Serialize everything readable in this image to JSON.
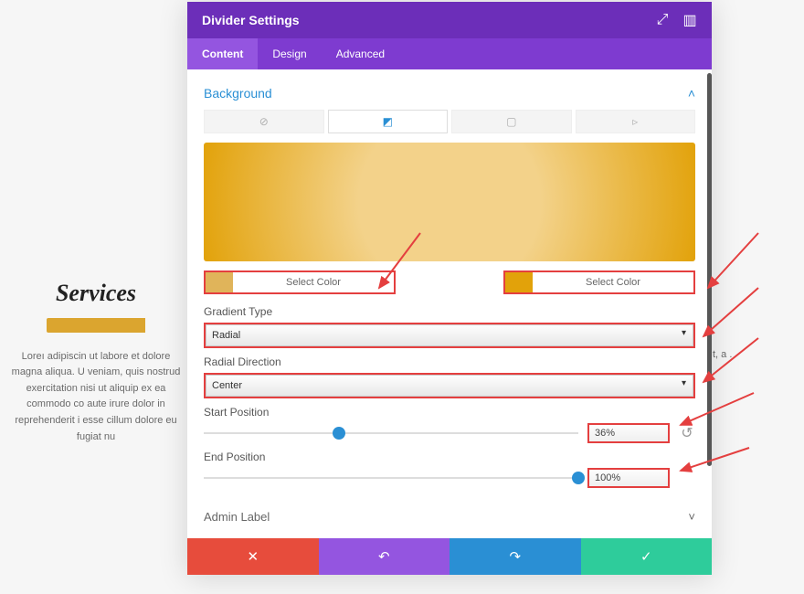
{
  "page": {
    "services_title": "Services",
    "lorem": "Loreı\nadipiscin\nut labore et dolore magna aliqua. U\nveniam, quis nostrud exercitation\nnisi ut aliquip ex ea commodo co\naute irure dolor in reprehenderit i\nesse cillum dolore eu fugiat nu",
    "lorem_right": "t,\n a\n.\n"
  },
  "modal": {
    "title": "Divider Settings",
    "tabs": {
      "content": "Content",
      "design": "Design",
      "advanced": "Advanced"
    },
    "section_background": "Background",
    "bg_type_icons": {
      "color": "⊘",
      "gradient": "◩",
      "image": "▢",
      "video": "▹"
    },
    "color1": {
      "swatch": "#e0b45a",
      "label": "Select Color"
    },
    "color2": {
      "swatch": "#e2a20a",
      "label": "Select Color"
    },
    "preview_gradient": "radial-gradient(circle at center, #f3d28a 0%, #f3d28a 36%, #e2a20a 100%)",
    "gradient_type": {
      "label": "Gradient Type",
      "value": "Radial"
    },
    "radial_direction": {
      "label": "Radial Direction",
      "value": "Center"
    },
    "start_position": {
      "label": "Start Position",
      "value": "36%",
      "pct": 36
    },
    "end_position": {
      "label": "End Position",
      "value": "100%",
      "pct": 100
    },
    "admin_label": "Admin Label",
    "footer": {
      "cancel": "✕",
      "undo": "↶",
      "redo": "↷",
      "save": "✓"
    },
    "header_icons": {
      "expand": "⤢",
      "cols": "▥"
    }
  }
}
